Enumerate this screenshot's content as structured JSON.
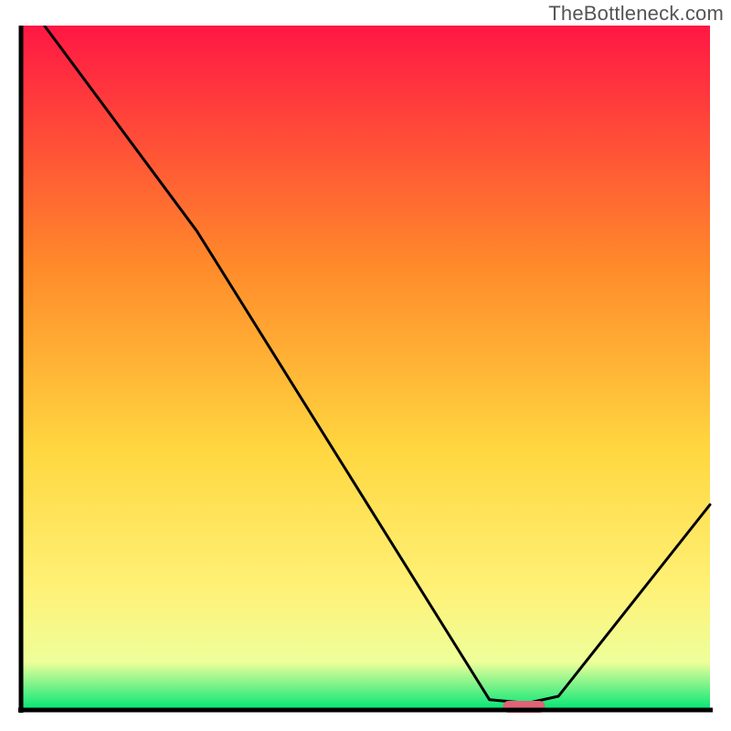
{
  "watermark": "TheBottleneck.com",
  "chart_data": {
    "type": "line",
    "title": "",
    "xlabel": "",
    "ylabel": "",
    "xlim": [
      0,
      100
    ],
    "ylim": [
      0,
      100
    ],
    "grid": false,
    "legend": false,
    "heat_gradient": {
      "top": "#ff1744",
      "upper_mid": "#ff8a2a",
      "mid": "#ffd740",
      "lower_mid": "#fff176",
      "near_bottom": "#eeff9a",
      "bottom": "#00e676"
    },
    "curve": {
      "description": "Bottleneck/miss-match curve; starts at top-left, descends, reaches zero near x≈72, then rises again toward the right.",
      "points": [
        {
          "x": 3.4,
          "y": 100.0
        },
        {
          "x": 25.5,
          "y": 70.0
        },
        {
          "x": 28.0,
          "y": 66.0
        },
        {
          "x": 68.0,
          "y": 1.5
        },
        {
          "x": 73.5,
          "y": 1.0
        },
        {
          "x": 78.0,
          "y": 2.0
        },
        {
          "x": 100.0,
          "y": 30.0
        }
      ]
    },
    "marker": {
      "description": "pink pill marker on x-axis indicating optimal zone",
      "x_center": 73.0,
      "y": 0.0,
      "color": "#e06377"
    },
    "axes": {
      "x_visible": true,
      "y_visible": true,
      "color": "#000000",
      "width": 3
    }
  }
}
